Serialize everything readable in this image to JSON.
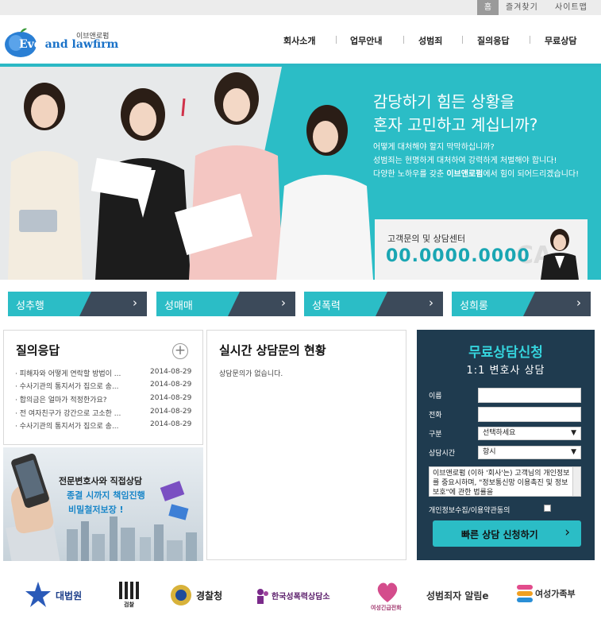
{
  "topbar": {
    "home_label": "홈",
    "favorites_label": "즐겨찾기",
    "sitemap_label": "사이트맵"
  },
  "logo": {
    "korean": "이브앤로펌",
    "english_a": "Eve",
    "english_b": "and lawfirm"
  },
  "nav": [
    "회사소개",
    "업무안내",
    "성범죄",
    "질의응답",
    "무료상담"
  ],
  "hero": {
    "headline_1": "감당하기 힘든 상황을",
    "headline_2": "혼자 고민하고 계십니까?",
    "body_1": "어떻게 대처해야 할지 막막하십니까?",
    "body_2": "성범죄는 현명하게 대처하여 강력하게 처벌해야 합니다!",
    "body_3_pre": "다양한 노하우를 갖춘 ",
    "body_3_brand": "이브앤로펌",
    "body_3_post": "에서 힘이 되어드리겠습니다!",
    "contact_label": "고객문의 및 상담센터",
    "contact_number": "00.0000.0000",
    "contact_ghost": "CA"
  },
  "categories": [
    "성추행",
    "성매매",
    "성폭력",
    "성희롱"
  ],
  "category_arrow": "›",
  "qa": {
    "title": "질의응답",
    "plus": "+",
    "rows": [
      {
        "q": "· 피해자와 어떻게 연락할 방법이 ...",
        "date": "2014-08-29"
      },
      {
        "q": "· 수사기관의 통지서가 집으로 송...",
        "date": "2014-08-29"
      },
      {
        "q": "· 합의금은 얼마가 적정한가요?",
        "date": "2014-08-29"
      },
      {
        "q": "· 전 여자친구가 강간으로 고소한 ...",
        "date": "2014-08-29"
      },
      {
        "q": "· 수사기관의 통지서가 집으로 송...",
        "date": "2014-08-29"
      }
    ]
  },
  "realtime": {
    "title": "실시간 상담문의 현황",
    "empty": "상담문의가 없습니다."
  },
  "banner": {
    "line1": "전문변호사와 직접상담",
    "line2": "종결 시까지 책임진행",
    "line3": "비밀철저보장 !"
  },
  "form": {
    "title": "무료상담신청",
    "subtitle": "1:1 변호사 상담",
    "name_label": "이름",
    "phone_label": "전화",
    "type_label": "구분",
    "type_value": "선택하세요",
    "time_label": "상담시간",
    "time_value": "항시",
    "select_arrow": "▼",
    "privacy_text": "이브앤로펌 (이하 '회사'는) 고객님의 개인정보를 중요시하며, \"정보통신망 이용촉진 및 정보보호\"에 관한 법률을",
    "agree_label": "개인정보수집/이용약관동의",
    "submit_label": "빠른 상담 신청하기",
    "submit_arrow": "›"
  },
  "footer_logos": [
    "대법원",
    "검찰",
    "경찰청",
    "한국성폭력상담소",
    "여성긴급전화",
    "성범죄자 알림e",
    "여성가족부"
  ],
  "colors": {
    "teal": "#2bbdc6",
    "navy": "#1f3b4f",
    "slate": "#3c4a5a"
  }
}
